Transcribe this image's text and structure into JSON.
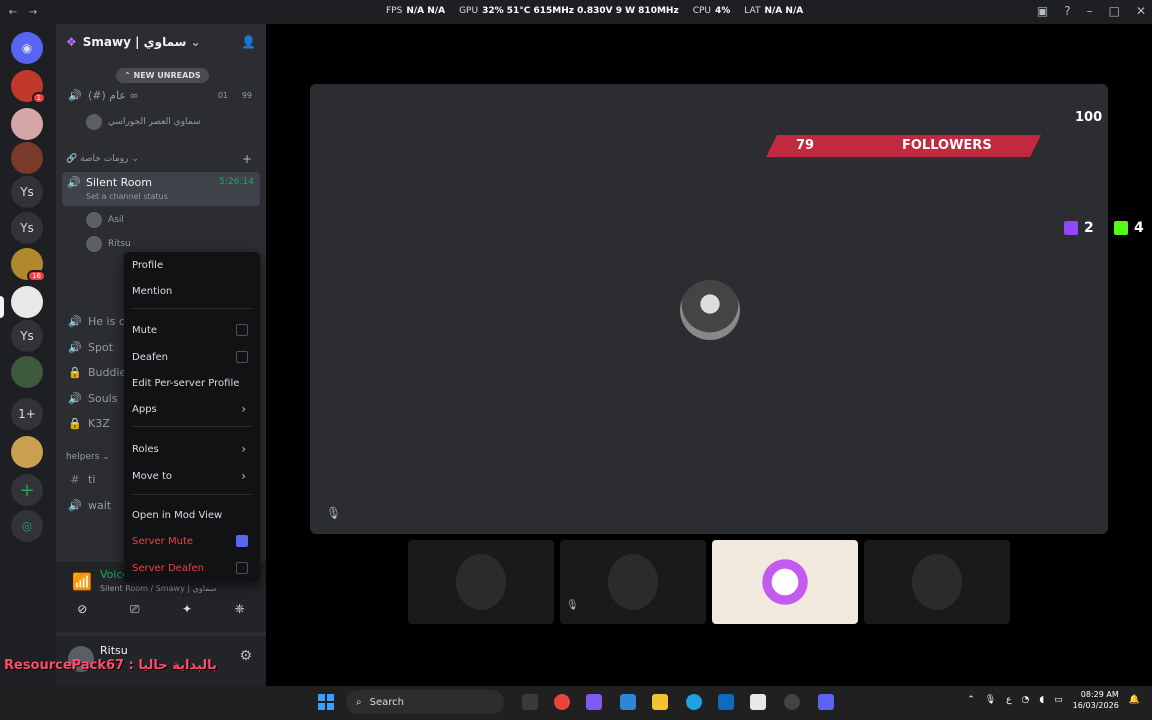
{
  "titlebar": {
    "back": "←",
    "forward": "→",
    "overlay": {
      "fps_label": "FPS",
      "fps_value": "N/A",
      "fps_value2": "N/A",
      "gpu_label": "GPU",
      "gpu_value": "32% 51°C 615MHz 0.830V 9 W 810MHz",
      "cpu_label": "CPU",
      "cpu_value": "4%",
      "lat_label": "LAT",
      "lat_value": "N/A",
      "lat_value2": "N/A"
    }
  },
  "server": {
    "name": "Smawy | سماوي",
    "new_unreads": "NEW UNREADS",
    "channels": [
      {
        "name": "(#) عام ∞",
        "counts": [
          "01",
          "99"
        ]
      },
      {
        "user": "سماوي العصر الجوراسي"
      }
    ],
    "private_category": "رومات خاصة",
    "silent_room": {
      "name": "Silent Room",
      "status": "Set a channel status",
      "timer": "5:26:14"
    },
    "members": [
      "Asil",
      "Ritsu"
    ],
    "lower_channels": [
      "He is c",
      "Spot",
      "Buddie",
      "Souls",
      "K3Z"
    ],
    "helpers_category": "helpers",
    "helper_channels": [
      "ti",
      "wait"
    ]
  },
  "rail": {
    "badges": [
      "1",
      "16"
    ],
    "labels": [
      "Ys",
      "Ys",
      "Ys",
      "1+"
    ]
  },
  "context_menu": {
    "items": [
      {
        "label": "Profile"
      },
      {
        "label": "Mention"
      },
      {
        "label": "Mute",
        "checked": false
      },
      {
        "label": "Deafen",
        "checked": false
      },
      {
        "label": "Edit Per-server Profile"
      },
      {
        "label": "Apps"
      },
      {
        "label": "Roles"
      },
      {
        "label": "Move to"
      },
      {
        "label": "Open in Mod View"
      },
      {
        "label": "Server Mute",
        "checked": true
      },
      {
        "label": "Server Deafen",
        "checked": false
      }
    ]
  },
  "voice_panel": {
    "title": "Voice Connect",
    "subtitle": "Silent Room / Smawy | سماوي"
  },
  "user_panel": {
    "name": "Ritsu"
  },
  "watermark": "ResourcePack67 : بالبداية حاليا",
  "stage": {
    "followers_count": "79",
    "followers_label": "FOLLOWERS",
    "followers_goal": "100",
    "twitch_count": "2",
    "kick_count": "4"
  },
  "taskbar": {
    "search": "Search",
    "lang": "ع",
    "time": "08:29 AM",
    "date": "16/03/2026"
  },
  "colors": {
    "accent": "#5865f2",
    "online": "#23a55a",
    "danger": "#f23f43",
    "followers_bar": "#c0293e"
  }
}
